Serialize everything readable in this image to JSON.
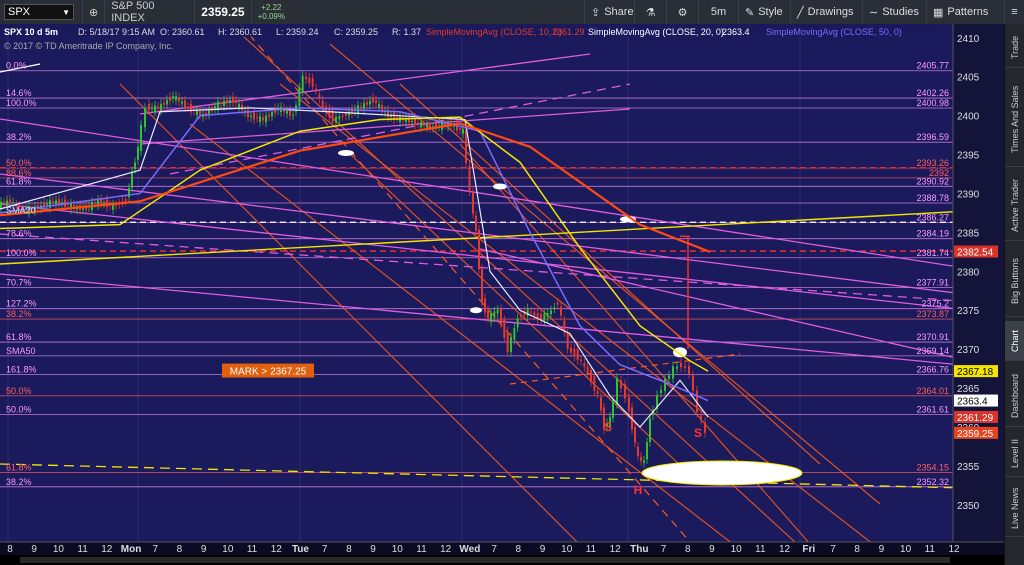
{
  "toolbar": {
    "symbol": "SPX",
    "index_name": "S&P 500 INDEX",
    "last_price": "2359.25",
    "change": "+2.22",
    "change_pct": "+0.09%",
    "share_label": "Share",
    "timeframe": "5m",
    "style_label": "Style",
    "drawings_label": "Drawings",
    "studies_label": "Studies",
    "patterns_label": "Patterns"
  },
  "sidebar": {
    "tabs": [
      {
        "label": "Trade",
        "active": false
      },
      {
        "label": "Times And Sales",
        "active": false
      },
      {
        "label": "Active Trader",
        "active": false
      },
      {
        "label": "Big Buttons",
        "active": false
      },
      {
        "label": "Chart",
        "active": true
      },
      {
        "label": "Dashboard",
        "active": false
      },
      {
        "label": "Level II",
        "active": false
      },
      {
        "label": "Live News",
        "active": false
      }
    ]
  },
  "header": {
    "title": "SPX 10 d 5m",
    "date": "D: 5/18/17 9:15 AM",
    "open": "O: 2360.61",
    "high": "H: 2360.61",
    "low": "L: 2359.24",
    "close": "C: 2359.25",
    "range": "R: 1.37",
    "sma10": "SimpleMovingAvg (CLOSE, 10, 0)",
    "sma10_val": "2361.29",
    "sma20": "SimpleMovingAvg (CLOSE, 20, 0)",
    "sma20_val": "2363.4",
    "sma50": "SimpleMovingAvg (CLOSE, 50, 0)",
    "copyright": "© 2017 © TD Ameritrade IP Company, Inc."
  },
  "chart_data": {
    "type": "candlestick",
    "ylim": [
      2346,
      2411
    ],
    "y_ticks": [
      2350,
      2355,
      2360,
      2365,
      2370,
      2375,
      2380,
      2385,
      2390,
      2395,
      2400,
      2405,
      2410
    ],
    "x_ticks": [
      "8",
      "9",
      "10",
      "11",
      "12",
      "Mon",
      "7",
      "8",
      "9",
      "10",
      "11",
      "12",
      "Tue",
      "7",
      "8",
      "9",
      "10",
      "11",
      "12",
      "Wed",
      "7",
      "8",
      "9",
      "10",
      "11",
      "12",
      "Thu",
      "7",
      "8",
      "9",
      "10",
      "11",
      "12",
      "Fri",
      "7",
      "8",
      "9",
      "10",
      "11",
      "12"
    ],
    "price_labels": [
      {
        "text": "2405.77",
        "value": 2405.77,
        "color": "#ff9aff"
      },
      {
        "text": "2402.26",
        "value": 2402.26,
        "color": "#ff9aff"
      },
      {
        "text": "2400.98",
        "value": 2400.98,
        "color": "#ff9aff"
      },
      {
        "text": "2396.59",
        "value": 2396.59,
        "color": "#ff9aff"
      },
      {
        "text": "2393.26",
        "value": 2393.26,
        "color": "#ff6060"
      },
      {
        "text": "2392",
        "value": 2392.0,
        "color": "#ff6060"
      },
      {
        "text": "2390.92",
        "value": 2390.92,
        "color": "#ff9aff"
      },
      {
        "text": "2388.78",
        "value": 2388.78,
        "color": "#ff9aff"
      },
      {
        "text": "2386.27",
        "value": 2386.27,
        "color": "#ff9aff"
      },
      {
        "text": "2384.19",
        "value": 2384.19,
        "color": "#ff9aff"
      },
      {
        "text": "2381.74",
        "value": 2381.74,
        "color": "#ff9aff"
      },
      {
        "text": "2377.91",
        "value": 2377.91,
        "color": "#ff9aff"
      },
      {
        "text": "2375.2",
        "value": 2375.2,
        "color": "#ff9aff"
      },
      {
        "text": "2373.87",
        "value": 2373.87,
        "color": "#ff6060"
      },
      {
        "text": "2370.91",
        "value": 2370.91,
        "color": "#ff9aff"
      },
      {
        "text": "2369.14",
        "value": 2369.14,
        "color": "#ff9aff"
      },
      {
        "text": "2366.76",
        "value": 2366.76,
        "color": "#ff9aff"
      },
      {
        "text": "2364.01",
        "value": 2364.01,
        "color": "#ff6060"
      },
      {
        "text": "2361.61",
        "value": 2361.61,
        "color": "#ff9aff"
      },
      {
        "text": "2354.15",
        "value": 2354.15,
        "color": "#ff6060"
      },
      {
        "text": "2352.32",
        "value": 2352.32,
        "color": "#ff9aff"
      }
    ],
    "fib_labels": [
      {
        "text": "0.0%",
        "value": 2405.77,
        "color": "#ff9aff"
      },
      {
        "text": "14.6%",
        "value": 2402.26,
        "color": "#ff9aff"
      },
      {
        "text": "100.0%",
        "value": 2400.98,
        "color": "#ff9aff"
      },
      {
        "text": "38.2%",
        "value": 2396.59,
        "color": "#ff9aff"
      },
      {
        "text": "50.0%",
        "value": 2393.26,
        "color": "#ff6060"
      },
      {
        "text": "88.6%",
        "value": 2392.0,
        "color": "#ff6060"
      },
      {
        "text": "61.8%",
        "value": 2390.92,
        "color": "#ff9aff"
      },
      {
        "text": "SMA20",
        "value": 2387.2,
        "color": "#dddddd"
      },
      {
        "text": "78.6%",
        "value": 2384.19,
        "color": "#ff9aff"
      },
      {
        "text": "100.0%",
        "value": 2381.74,
        "color": "#ff9aff"
      },
      {
        "text": "70.7%",
        "value": 2377.91,
        "color": "#ff9aff"
      },
      {
        "text": "127.2%",
        "value": 2375.2,
        "color": "#ff9aff"
      },
      {
        "text": "38.2%",
        "value": 2373.87,
        "color": "#ff6060"
      },
      {
        "text": "61.8%",
        "value": 2370.91,
        "color": "#ff9aff"
      },
      {
        "text": "SMA50",
        "value": 2369.14,
        "color": "#ff9aff"
      },
      {
        "text": "161.8%",
        "value": 2366.76,
        "color": "#ff9aff"
      },
      {
        "text": "50.0%",
        "value": 2364.01,
        "color": "#ff6060"
      },
      {
        "text": "50.0%",
        "value": 2361.61,
        "color": "#ff9aff"
      },
      {
        "text": "61.8%",
        "value": 2354.15,
        "color": "#ff6060"
      },
      {
        "text": "38.2%",
        "value": 2352.32,
        "color": "#ff9aff"
      }
    ],
    "axis_badges": [
      {
        "text": "2382.54",
        "value": 2382.54,
        "bg": "#d9342b",
        "fg": "#ffffff"
      },
      {
        "text": "2367.18",
        "value": 2367.18,
        "bg": "#f2e600",
        "fg": "#000000"
      },
      {
        "text": "2363.4",
        "value": 2363.4,
        "bg": "#ffffff",
        "fg": "#000000"
      },
      {
        "text": "2361.29",
        "value": 2361.29,
        "bg": "#d9342b",
        "fg": "#ffffff"
      },
      {
        "text": "2359.25",
        "value": 2359.25,
        "bg": "#e8431f",
        "fg": "#ffffff"
      }
    ],
    "mark": {
      "label": "MARK > 2367.25",
      "value": 2367.25
    },
    "pattern_labels": [
      {
        "text": "S",
        "value": 2359.5
      },
      {
        "text": "H",
        "value": 2351.4
      },
      {
        "text": "S",
        "value": 2358.7
      }
    ],
    "close_path": [
      [
        0,
        2388.5
      ],
      [
        12,
        2389
      ],
      [
        25,
        2388
      ],
      [
        40,
        2388.2
      ],
      [
        55,
        2389
      ],
      [
        70,
        2388.5
      ],
      [
        85,
        2388
      ],
      [
        100,
        2389
      ],
      [
        115,
        2388.3
      ],
      [
        128,
        2389.2
      ],
      [
        140,
        2396
      ],
      [
        148,
        2401
      ],
      [
        160,
        2401
      ],
      [
        175,
        2402.5
      ],
      [
        190,
        2401
      ],
      [
        205,
        2400
      ],
      [
        220,
        2401.5
      ],
      [
        235,
        2402
      ],
      [
        250,
        2400
      ],
      [
        265,
        2399.5
      ],
      [
        280,
        2401
      ],
      [
        295,
        2400
      ],
      [
        305,
        2405
      ],
      [
        315,
        2404
      ],
      [
        325,
        2401
      ],
      [
        335,
        2399.5
      ],
      [
        345,
        2400
      ],
      [
        360,
        2401
      ],
      [
        375,
        2402
      ],
      [
        390,
        2400
      ],
      [
        405,
        2399.5
      ],
      [
        420,
        2399
      ],
      [
        435,
        2398.5
      ],
      [
        450,
        2399
      ],
      [
        465,
        2398
      ],
      [
        472,
        2390
      ],
      [
        478,
        2385
      ],
      [
        484,
        2376
      ],
      [
        490,
        2374
      ],
      [
        500,
        2375
      ],
      [
        510,
        2370
      ],
      [
        520,
        2374
      ],
      [
        530,
        2375
      ],
      [
        540,
        2374
      ],
      [
        550,
        2374.5
      ],
      [
        560,
        2376
      ],
      [
        570,
        2370
      ],
      [
        580,
        2369
      ],
      [
        590,
        2367
      ],
      [
        600,
        2364
      ],
      [
        606,
        2360
      ],
      [
        612,
        2361
      ],
      [
        620,
        2366
      ],
      [
        628,
        2364
      ],
      [
        634,
        2360
      ],
      [
        640,
        2356
      ],
      [
        646,
        2355.5
      ],
      [
        652,
        2361
      ],
      [
        660,
        2364
      ],
      [
        668,
        2366
      ],
      [
        676,
        2367.5
      ],
      [
        684,
        2368
      ],
      [
        692,
        2367
      ],
      [
        700,
        2362
      ],
      [
        708,
        2359.25
      ]
    ],
    "sma10": [
      [
        0,
        2388
      ],
      [
        140,
        2393
      ],
      [
        160,
        2400.5
      ],
      [
        250,
        2401
      ],
      [
        330,
        2400.5
      ],
      [
        465,
        2399.5
      ],
      [
        490,
        2380
      ],
      [
        520,
        2375
      ],
      [
        570,
        2372
      ],
      [
        610,
        2364
      ],
      [
        640,
        2360
      ],
      [
        680,
        2366
      ],
      [
        708,
        2361.29
      ]
    ],
    "sma20": [
      [
        0,
        2387.5
      ],
      [
        140,
        2390
      ],
      [
        200,
        2400
      ],
      [
        300,
        2401
      ],
      [
        400,
        2400.5
      ],
      [
        480,
        2398
      ],
      [
        530,
        2385
      ],
      [
        580,
        2373
      ],
      [
        620,
        2368
      ],
      [
        670,
        2365.5
      ],
      [
        708,
        2363.4
      ]
    ],
    "sma50": [
      [
        0,
        2385.5
      ],
      [
        120,
        2386
      ],
      [
        200,
        2393
      ],
      [
        300,
        2398
      ],
      [
        380,
        2399.5
      ],
      [
        460,
        2399.8
      ],
      [
        520,
        2394
      ],
      [
        580,
        2383
      ],
      [
        640,
        2373
      ],
      [
        690,
        2368.5
      ],
      [
        708,
        2367.18
      ]
    ]
  }
}
